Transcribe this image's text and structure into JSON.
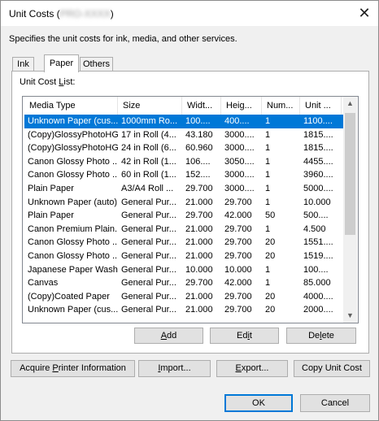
{
  "window": {
    "title": "Unit Costs (",
    "title_suffix": ")",
    "close_glyph": "✕"
  },
  "description": "Specifies the unit costs for ink, media, and other services.",
  "tabs": [
    {
      "label": "Ink",
      "active": false
    },
    {
      "label": "Paper",
      "active": true
    },
    {
      "label": "Others",
      "active": false
    }
  ],
  "list": {
    "label": "Unit Cost List:",
    "label_mnemonic": "L",
    "columns": [
      "Media Type",
      "Size",
      "Widt...",
      "Heig...",
      "Num...",
      "Unit ..."
    ],
    "rows": [
      [
        "Unknown Paper (cus...",
        "1000mm Ro...",
        "100....",
        "400....",
        "1",
        "1100...."
      ],
      [
        "(Copy)GlossyPhotoHG1",
        "17 in Roll (4...",
        "43.180",
        "3000....",
        "1",
        "1815...."
      ],
      [
        "(Copy)GlossyPhotoHG1",
        "24 in Roll (6...",
        "60.960",
        "3000....",
        "1",
        "1815...."
      ],
      [
        "Canon Glossy Photo ...",
        "42 in Roll (1...",
        "106....",
        "3050....",
        "1",
        "4455...."
      ],
      [
        "Canon Glossy Photo ...",
        "60 in Roll (1...",
        "152....",
        "3000....",
        "1",
        "3960...."
      ],
      [
        "Plain Paper",
        "A3/A4 Roll ...",
        "29.700",
        "3000....",
        "1",
        "5000...."
      ],
      [
        "Unknown Paper (auto)",
        "General Pur...",
        "21.000",
        "29.700",
        "1",
        "10.000"
      ],
      [
        "Plain Paper",
        "General Pur...",
        "29.700",
        "42.000",
        "50",
        "500...."
      ],
      [
        "Canon Premium Plain...",
        "General Pur...",
        "21.000",
        "29.700",
        "1",
        "4.500"
      ],
      [
        "Canon Glossy Photo ...",
        "General Pur...",
        "21.000",
        "29.700",
        "20",
        "1551...."
      ],
      [
        "Canon Glossy Photo ...",
        "General Pur...",
        "21.000",
        "29.700",
        "20",
        "1519...."
      ],
      [
        "Japanese Paper Washi",
        "General Pur...",
        "10.000",
        "10.000",
        "1",
        "100...."
      ],
      [
        "Canvas",
        "General Pur...",
        "29.700",
        "42.000",
        "1",
        "85.000"
      ],
      [
        "(Copy)Coated Paper",
        "General Pur...",
        "21.000",
        "29.700",
        "20",
        "4000...."
      ],
      [
        "Unknown Paper (cus...",
        "General Pur...",
        "21.000",
        "29.700",
        "20",
        "2000...."
      ]
    ],
    "selected_index": 0
  },
  "list_buttons": {
    "add": "Add",
    "edit": "Edit",
    "delete": "Delete"
  },
  "action_buttons": {
    "acquire": "Acquire Printer Information",
    "import": "Import...",
    "export": "Export...",
    "copy_unit_cost": "Copy Unit Cost"
  },
  "footer": {
    "ok": "OK",
    "cancel": "Cancel"
  },
  "colors": {
    "selection": "#0078d7",
    "dialog_bg": "#f0f0f0",
    "default_button_border": "#0078d7"
  }
}
